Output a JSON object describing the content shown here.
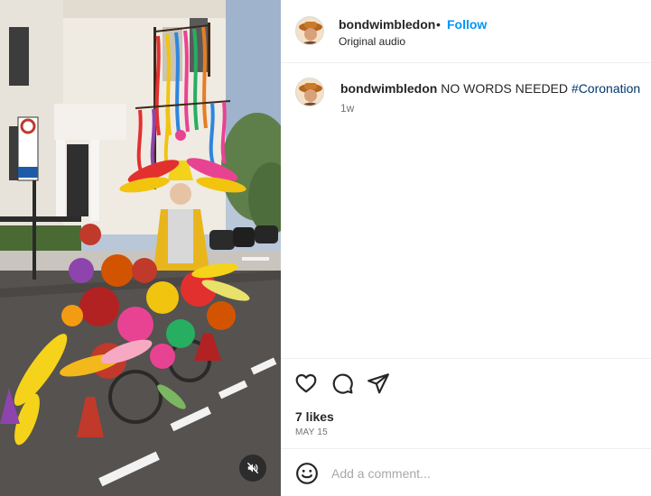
{
  "header": {
    "username": "bondwimbledon",
    "separator": "•",
    "follow_label": "Follow",
    "audio_label": "Original audio"
  },
  "caption": {
    "username": "bondwimbledon",
    "text": "NO WORDS NEEDED ",
    "hashtag": "#Coronation",
    "time_ago": "1w"
  },
  "actions": {
    "like_icon": "heart-icon",
    "comment_icon": "comment-icon",
    "share_icon": "send-icon"
  },
  "stats": {
    "likes": "7 likes",
    "date": "MAY 15"
  },
  "comment_box": {
    "placeholder": "Add a comment...",
    "emoji_icon": "smiley-icon"
  },
  "media": {
    "type": "video",
    "muted_icon": "speaker-muted-icon"
  },
  "colors": {
    "follow_blue": "#0095f6",
    "hashtag_blue": "#00376b",
    "muted_text": "#737373"
  }
}
